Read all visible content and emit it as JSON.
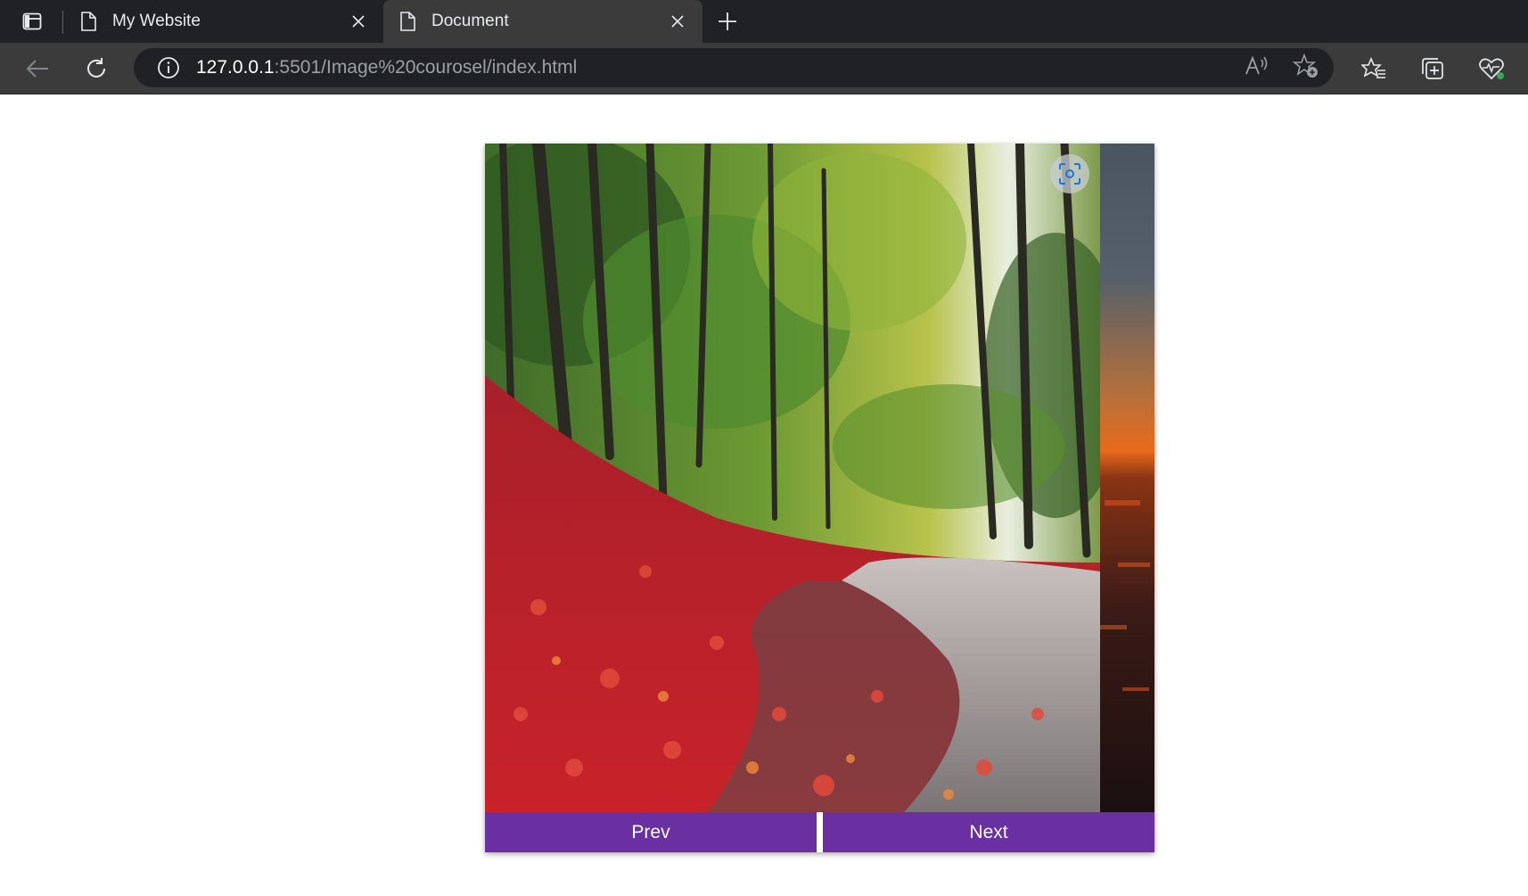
{
  "browser": {
    "tabs": [
      {
        "title": "My Website",
        "active": false
      },
      {
        "title": "Document",
        "active": true
      }
    ],
    "address": {
      "host": "127.0.0.1",
      "rest": ":5501/Image%20courosel/index.html"
    },
    "icons": [
      "sidebar-toggle-icon",
      "page-icon",
      "close-icon",
      "plus-icon",
      "back-arrow-icon",
      "refresh-icon",
      "info-icon",
      "read-aloud-icon",
      "add-favorite-icon",
      "favorites-icon",
      "collections-icon",
      "browser-essentials-icon"
    ]
  },
  "carousel": {
    "prev_label": "Prev",
    "next_label": "Next",
    "accent": "#6a2fa0"
  }
}
